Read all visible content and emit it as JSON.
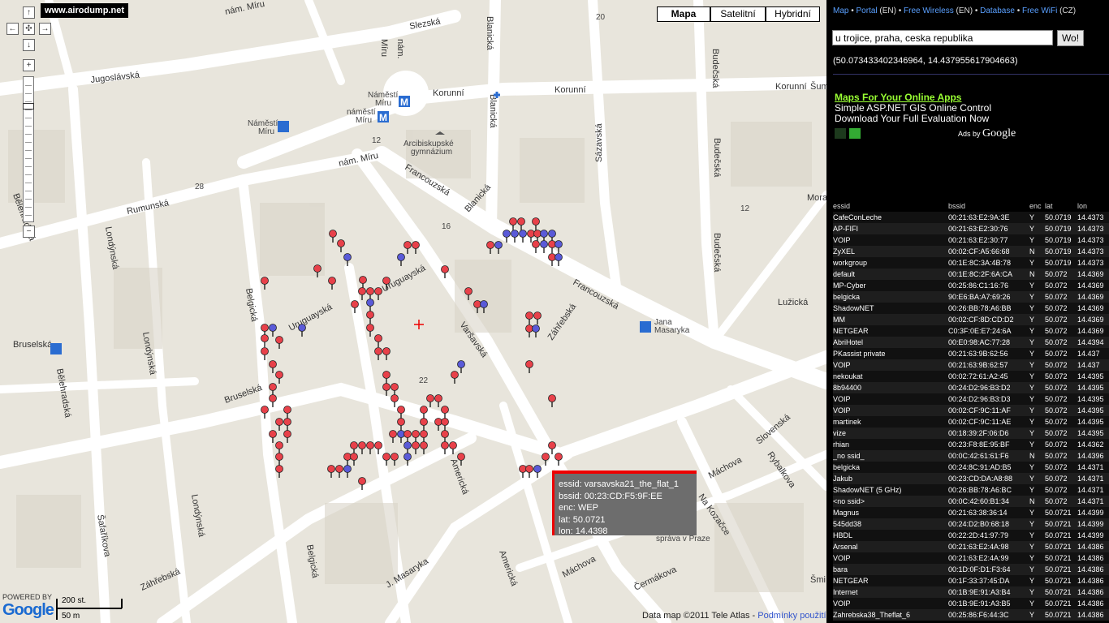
{
  "site_tag": "www.airodump.net",
  "nav": {
    "up": "↑",
    "left": "←",
    "center": "✣",
    "right": "→",
    "down": "↓",
    "zoom_in": "+",
    "zoom_out": "−"
  },
  "map_types": [
    "Mapa",
    "Satelitní",
    "Hybridní"
  ],
  "map_type_selected": "Mapa",
  "streets": {
    "nam_miru_1": "nám. Míru",
    "nam_miru_2": "nám.",
    "nam_miru_3": "Míru",
    "nam_miru_4": "nám. Míru",
    "jugoslavska": "Jugoslávská",
    "slezska": "Slezská",
    "korunni_1": "Korunní",
    "korunni_2": "Korunní",
    "korunni_3": "Korunní",
    "rumunska": "Rumunská",
    "francouzska_1": "Francouzská",
    "francouzska_2": "Francouzská",
    "blanicka_1": "Blanická",
    "blanicka_2": "Blanická",
    "blanicka_3": "Blanická",
    "sazavska": "Sázavská",
    "budecska_1": "Budečská",
    "budecska_2": "Budečská",
    "budecska_3": "Budečská",
    "uruguayska_1": "Uruguayská",
    "uruguayska_2": "Uruguayská",
    "varsavska": "Varšavská",
    "zahrebska_1": "Záhřebská",
    "zahrebska_2": "Záhřebská",
    "belgicka_1": "Belgická",
    "belgicka_2": "Belgická",
    "bruselska_1": "Bruselská",
    "bruselska_2": "Bruselská",
    "londynska_1": "Londýnská",
    "londynska_2": "Londýnská",
    "londynska_3": "Londýnská",
    "belehradska_1": "Bělehradská",
    "belehradska_2": "Bělehradská",
    "safarikova": "Šafaříkova",
    "americka_1": "Americká",
    "americka_2": "Americká",
    "j_masaryka": "J. Masaryka",
    "machova_1": "Máchova",
    "machova_2": "Máchova",
    "slovenska": "Slovenská",
    "rybalkova": "Rybalkova",
    "na_kozacce": "Na Kozačce",
    "lucni": "Lužická",
    "cermakova": "Čermákova",
    "mora": "Mora",
    "sumava": "Šum",
    "smi": "Šmi"
  },
  "pois": {
    "namesti_miru_stop_1": "Náměstí",
    "namesti_miru_stop_2": "Míru",
    "namesti_miru_metro_1": "Náměstí",
    "namesti_miru_metro_2": "Míru",
    "namesti_miru_metro_3": "náměstí",
    "namesti_miru_metro_4": "Míru",
    "gymnasium_1": "Arcibiskupské",
    "gymnasium_2": "gymnázium",
    "jana_masaryka_1": "Jana",
    "jana_masaryka_2": "Masaryka",
    "bruselska_stop": "Bruselská",
    "sprava": "správa v Praze"
  },
  "street_numbers": [
    "20",
    "28",
    "12",
    "16",
    "22",
    "12"
  ],
  "tooltip": {
    "essid": "essid: varsavska21_the_flat_1",
    "bssid": "bssid: 00:23:CD:F5:9F:EE",
    "enc": "enc: WEP",
    "lat": "lat: 50.0721",
    "lon": "lon: 14.4398"
  },
  "scale": {
    "feet": "200 st.",
    "meters": "50 m"
  },
  "google_powered": "POWERED BY",
  "google_logo": "Google",
  "copyright": "Data map ©2011 Tele Atlas -",
  "terms_link": "Podmínky použití",
  "sidebar": {
    "links": [
      {
        "label": "Map",
        "link": true
      },
      {
        "label": " • ",
        "link": false
      },
      {
        "label": "Portal",
        "link": true
      },
      {
        "label": " (EN) • ",
        "link": false
      },
      {
        "label": "Free Wireless",
        "link": true
      },
      {
        "label": " (EN) • ",
        "link": false
      },
      {
        "label": "Database",
        "link": true
      },
      {
        "label": " • ",
        "link": false
      },
      {
        "label": "Free WiFi",
        "link": true
      },
      {
        "label": " (CZ)",
        "link": false
      }
    ],
    "search_value": "u trojice, praha, ceska republika",
    "search_button": "Wo!",
    "coordinates": "(50.073433402346964, 14.437955617904663)",
    "ad_title": "Maps For Your Online Apps",
    "ad_line1": "Simple ASP.NET GIS Online Control",
    "ad_line2": "Download Your Full Evaluation Now",
    "ads_by": "Ads by",
    "ads_by_brand": "Google"
  },
  "table": {
    "headers": [
      "essid",
      "bssid",
      "enc",
      "lat",
      "lon"
    ],
    "rows": [
      [
        "CafeConLeche",
        "00:21:63:E2:9A:3E",
        "Y",
        "50.0719",
        "14.4373"
      ],
      [
        "AP-FIFI",
        "00:21:63:E2:30:76",
        "Y",
        "50.0719",
        "14.4373"
      ],
      [
        "VOIP",
        "00:21:63:E2:30:77",
        "Y",
        "50.0719",
        "14.4373"
      ],
      [
        "ZyXEL",
        "00:02:CF:A5:66:68",
        "N",
        "50.0719",
        "14.4373"
      ],
      [
        "workgroup",
        "00:1E:8C:3A:4B:78",
        "Y",
        "50.0719",
        "14.4373"
      ],
      [
        "default",
        "00:1E:8C:2F:6A:CA",
        "N",
        "50.072",
        "14.4369"
      ],
      [
        "MP-Cyber",
        "00:25:86:C1:16:76",
        "Y",
        "50.072",
        "14.4369"
      ],
      [
        "belgicka",
        "90:E6:BA:A7:69:26",
        "Y",
        "50.072",
        "14.4369"
      ],
      [
        "ShadowNET",
        "00:26:BB:78:A6:BB",
        "Y",
        "50.072",
        "14.4369"
      ],
      [
        "MM",
        "00:02:CF:8D:CD:D2",
        "Y",
        "50.072",
        "14.4369"
      ],
      [
        "NETGEAR",
        "C0:3F:0E:E7:24:6A",
        "Y",
        "50.072",
        "14.4369"
      ],
      [
        "AbriHotel",
        "00:E0:98:AC:77:28",
        "Y",
        "50.072",
        "14.4394"
      ],
      [
        "PKassist private",
        "00:21:63:9B:62:56",
        "Y",
        "50.072",
        "14.437"
      ],
      [
        "VOIP",
        "00:21:63:9B:62:57",
        "Y",
        "50.072",
        "14.437"
      ],
      [
        "nekoukat",
        "00:02:72:61:A2:45",
        "Y",
        "50.072",
        "14.4395"
      ],
      [
        "8b94400",
        "00:24:D2:96:B3:D2",
        "Y",
        "50.072",
        "14.4395"
      ],
      [
        "VOIP",
        "00:24:D2:96:B3:D3",
        "Y",
        "50.072",
        "14.4395"
      ],
      [
        "VOIP",
        "00:02:CF:9C:11:AF",
        "Y",
        "50.072",
        "14.4395"
      ],
      [
        "martinek",
        "00:02:CF:9C:11:AE",
        "Y",
        "50.072",
        "14.4395"
      ],
      [
        "vize",
        "00:18:39:2F:06:D6",
        "Y",
        "50.072",
        "14.4395"
      ],
      [
        "rhian",
        "00:23:F8:8E:95:BF",
        "Y",
        "50.072",
        "14.4362"
      ],
      [
        "_no ssid_",
        "00:0C:42:61:61:F6",
        "N",
        "50.072",
        "14.4396"
      ],
      [
        "belgicka",
        "00:24:8C:91:AD:B5",
        "Y",
        "50.072",
        "14.4371"
      ],
      [
        "Jakub",
        "00:23:CD:DA:A8:88",
        "Y",
        "50.072",
        "14.4371"
      ],
      [
        "ShadowNET (5 GHz)",
        "00:26:BB:78:A6:BC",
        "Y",
        "50.072",
        "14.4371"
      ],
      [
        "<no ssid>",
        "00:0C:42:60:B1:34",
        "N",
        "50.072",
        "14.4371"
      ],
      [
        "Magnus",
        "00:21:63:38:36:14",
        "Y",
        "50.0721",
        "14.4399"
      ],
      [
        "545dd38",
        "00:24:D2:B0:68:18",
        "Y",
        "50.0721",
        "14.4399"
      ],
      [
        "HBDL",
        "00:22:2D:41:97:79",
        "Y",
        "50.0721",
        "14.4399"
      ],
      [
        "Arsenal",
        "00:21:63:E2:4A:98",
        "Y",
        "50.0721",
        "14.4386"
      ],
      [
        "VOIP",
        "00:21:63:E2:4A:99",
        "Y",
        "50.0721",
        "14.4386"
      ],
      [
        "bara",
        "00:1D:0F:D1:F3:64",
        "Y",
        "50.0721",
        "14.4386"
      ],
      [
        "NETGEAR",
        "00:1F:33:37:45:DA",
        "Y",
        "50.0721",
        "14.4386"
      ],
      [
        "Internet",
        "00:1B:9E:91:A3:B4",
        "Y",
        "50.0721",
        "14.4386"
      ],
      [
        "VOIP",
        "00:1B:9E:91:A3:B5",
        "Y",
        "50.0721",
        "14.4386"
      ],
      [
        "Zahrebska38_Theflat_6",
        "00:25:86:F6:44:3C",
        "Y",
        "50.0721",
        "14.4386"
      ]
    ]
  },
  "colors": {
    "open_marker": "#e8414a",
    "secure_marker": "#5a5ad8",
    "tooltip_border": "#ee0000",
    "ad_title": "#99ff33",
    "link": "#5aa0ff"
  }
}
